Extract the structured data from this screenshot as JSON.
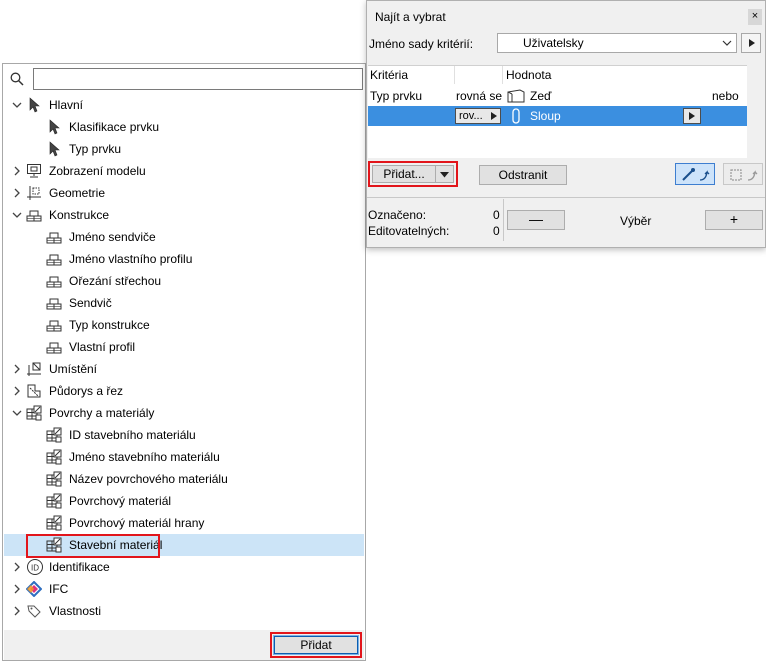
{
  "tree_panel": {
    "search": {
      "value": "",
      "placeholder": ""
    },
    "items": [
      {
        "label": "Hlavní",
        "icon": "arrow-cursor-icon",
        "expanded": true
      },
      {
        "label": "Klasifikace prvku",
        "icon": "arrow-cursor-icon"
      },
      {
        "label": "Typ prvku",
        "icon": "arrow-cursor-icon"
      },
      {
        "label": "Zobrazení modelu",
        "icon": "monitor-icon",
        "expanded": false
      },
      {
        "label": "Geometrie",
        "icon": "geometry-icon",
        "expanded": false
      },
      {
        "label": "Konstrukce",
        "icon": "bricks-icon",
        "expanded": true
      },
      {
        "label": "Jméno sendviče",
        "icon": "bricks-icon"
      },
      {
        "label": "Jméno vlastního profilu",
        "icon": "bricks-icon"
      },
      {
        "label": "Ořezání střechou",
        "icon": "bricks-icon"
      },
      {
        "label": "Sendvič",
        "icon": "bricks-icon"
      },
      {
        "label": "Typ konstrukce",
        "icon": "bricks-icon"
      },
      {
        "label": "Vlastní profil",
        "icon": "bricks-icon"
      },
      {
        "label": "Umístění",
        "icon": "placement-icon",
        "expanded": false
      },
      {
        "label": "Půdorys a řez",
        "icon": "plan-section-icon",
        "expanded": false
      },
      {
        "label": "Povrchy a materiály",
        "icon": "materials-icon",
        "expanded": true
      },
      {
        "label": "ID stavebního materiálu",
        "icon": "materials-icon"
      },
      {
        "label": "Jméno stavebního materiálu",
        "icon": "materials-icon"
      },
      {
        "label": "Název povrchového materiálu",
        "icon": "materials-icon"
      },
      {
        "label": "Povrchový materiál",
        "icon": "materials-icon"
      },
      {
        "label": "Povrchový materiál hrany",
        "icon": "materials-icon"
      },
      {
        "label": "Stavební materiál",
        "icon": "materials-icon",
        "selected": true
      },
      {
        "label": "Identifikace",
        "icon": "id-icon",
        "expanded": false
      },
      {
        "label": "IFC",
        "icon": "ifc-icon",
        "expanded": false
      },
      {
        "label": "Vlastnosti",
        "icon": "tag-icon",
        "expanded": false
      }
    ],
    "add_button_label": "Přidat"
  },
  "dialog": {
    "title": "Najít a vybrat",
    "close_glyph": "×",
    "criteria_set_label": "Jméno sady kritérií:",
    "criteria_set_value": "Uživatelsky",
    "table": {
      "headers": {
        "criteria": "Kritéria",
        "value": "Hodnota"
      },
      "rows": [
        {
          "criteria": "Typ prvku",
          "operator": "rovná se",
          "value": "Zeď",
          "logic": "nebo"
        },
        {
          "criteria": "",
          "operator": "rov...",
          "value": "Sloup",
          "logic": ""
        }
      ]
    },
    "add_button_label": "Přidat...",
    "remove_button_label": "Odstranit",
    "marked_label": "Označeno:",
    "marked_value": "0",
    "editable_label": "Editovatelných:",
    "editable_value": "0",
    "minus_label": "—",
    "selection_label": "Výběr",
    "plus_label": "+"
  },
  "colors": {
    "highlight_red": "#e2151b",
    "selected_row_blue": "#3b8fe0",
    "tree_selection": "#cce4f7"
  }
}
